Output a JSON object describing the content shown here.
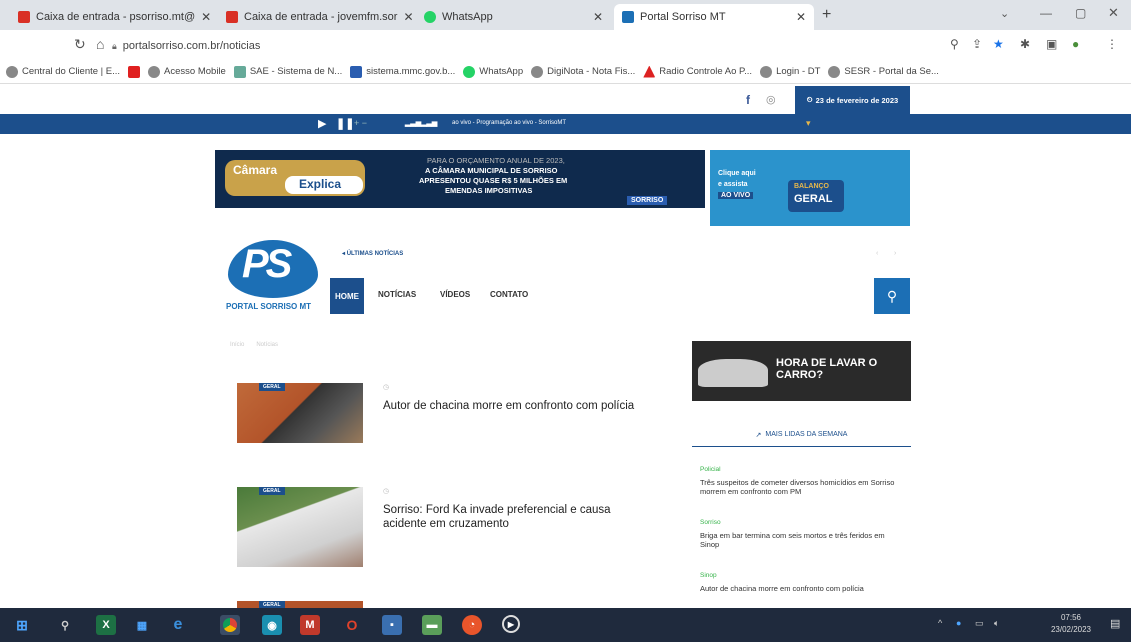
{
  "browser": {
    "tabs": [
      {
        "label": "Caixa de entrada - psorriso.mt@"
      },
      {
        "label": "Caixa de entrada - jovemfm.sor"
      },
      {
        "label": "WhatsApp"
      },
      {
        "label": "Portal Sorriso MT"
      }
    ],
    "new_tab": "+",
    "url": "portalsorriso.com.br/noticias"
  },
  "bookmarks": [
    "Central do Cliente | E...",
    "Acesso Mobile",
    "SAE - Sistema de N...",
    "sistema.mmc.gov.b...",
    "WhatsApp",
    "DigiNota - Nota Fis...",
    "Radio Controle Ao P...",
    "Login - DT",
    "SESR - Portal da Se..."
  ],
  "site": {
    "date": "23 de fevereiro de 2023",
    "radio_text": "ao vivo - Programação ao vivo - SorrisoMT",
    "banner1": {
      "badge_top": "Câmara",
      "badge_bottom": "Explica",
      "line1": "PARA O ORÇAMENTO ANUAL DE 2023,",
      "line2": "A CÂMARA MUNICIPAL DE SORRISO",
      "line3": "APRESENTOU QUASE R$ 5 MILHÕES EM",
      "line4": "EMENDAS IMPOSITIVAS",
      "brand": "SORRISO"
    },
    "banner2": {
      "line1": "Clique aqui",
      "line2": "e assista",
      "line3": "AO VIVO",
      "logo_top": "BALANÇO",
      "logo_bottom": "GERAL"
    },
    "logo": {
      "mark": "PS",
      "text": "PORTAL SORRISO MT"
    },
    "ticker_label": "ÚLTIMAS NOTÍCIAS",
    "menu": [
      "HOME",
      "NOTÍCIAS",
      "VÍDEOS",
      "CONTATO"
    ],
    "breadcrumb": [
      "Início",
      "Notícias"
    ],
    "articles": [
      {
        "tag": "GERAL",
        "title": "Autor de chacina morre em confronto com polícia"
      },
      {
        "tag": "GERAL",
        "title": "Sorriso: Ford Ka invade preferencial e causa acidente em cruzamento"
      },
      {
        "tag": "GERAL",
        "title": ""
      }
    ],
    "ad_car": "HORA DE LAVAR O CARRO?",
    "sidebar_title": "MAIS LIDAS DA SEMANA",
    "sidebar_items": [
      {
        "cat": "Policial",
        "title": "Três suspeitos de cometer diversos homicídios em Sorriso morrem em confronto com PM"
      },
      {
        "cat": "Sorriso",
        "title": "Briga em bar termina com seis mortos e três feridos em Sinop"
      },
      {
        "cat": "Sinop",
        "title": "Autor de chacina morre em confronto com polícia"
      }
    ]
  },
  "taskbar": {
    "time": "07:56",
    "date": "23/02/2023"
  },
  "colors": {
    "brand_blue": "#1c4f8c",
    "taskbar": "#1f2a3d"
  }
}
